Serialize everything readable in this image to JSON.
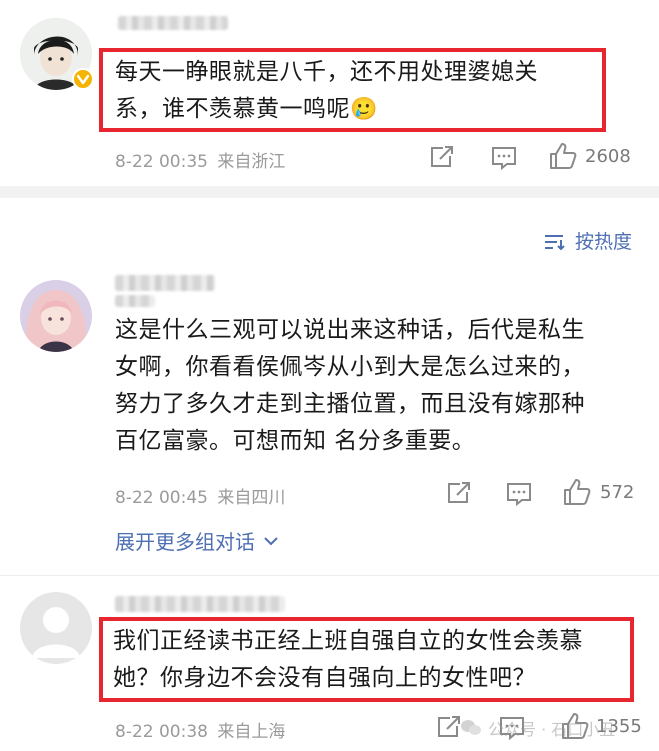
{
  "comments": [
    {
      "text_line1": "每天一睁眼就是八千，还不用处理婆媳关",
      "text_line2": "系，谁不羡慕黄一鸣呢",
      "emoji": "🥲",
      "time": "8-22 00:35",
      "location": "来自浙江",
      "likes": "2608"
    },
    {
      "lines": [
        "这是什么三观可以说出来这种话，后代是私生",
        "女啊，你看看侯佩岑从小到大是怎么过来的，",
        "努力了多久才走到主播位置，而且没有嫁那种",
        "百亿富豪。可想而知 名分多重要。"
      ],
      "time": "8-22 00:45",
      "location": "来自四川",
      "likes": "572",
      "expand_label": "展开更多组对话"
    },
    {
      "text_line1": "我们正经读书正经上班自强自立的女性会羡慕",
      "text_line2": "她？你身边不会没有自强向上的女性吧？",
      "time": "8-22 00:38",
      "location": "来自上海",
      "likes": "1355"
    }
  ],
  "sort_label": "按热度",
  "watermark": "公众号 · 石口小丑",
  "colors": {
    "highlight": "#e8262f",
    "link": "#4f6fb3",
    "meta": "#9a9a9a",
    "verified": "#f5b400"
  }
}
